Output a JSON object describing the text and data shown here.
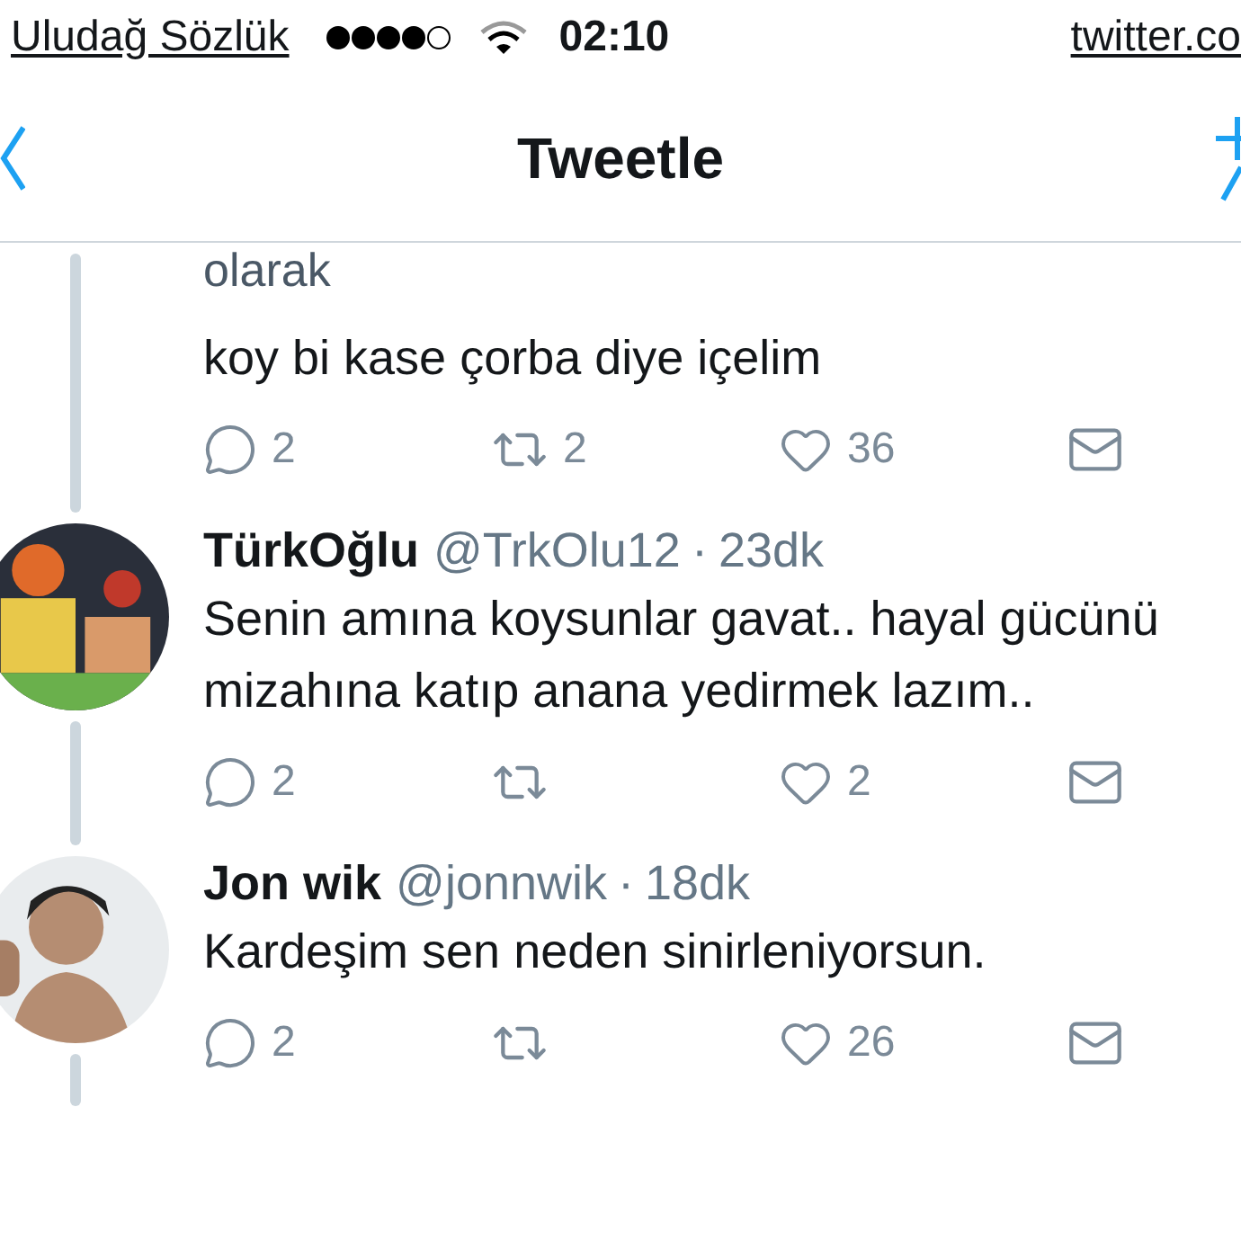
{
  "status_bar": {
    "carrier": "Uludağ Sözlük",
    "time": "02:10",
    "url": "twitter.co"
  },
  "nav": {
    "title": "Tweetle"
  },
  "tweets": [
    {
      "context": "olarak",
      "text": "koy bi kase çorba diye içelim",
      "actions": [
        {
          "kind": "reply",
          "count": "2"
        },
        {
          "kind": "retweet",
          "count": "2"
        },
        {
          "kind": "like",
          "count": "36"
        },
        {
          "kind": "message"
        }
      ]
    },
    {
      "name": "TürkOğlu",
      "handle": "@TrkOlu12",
      "dot": "·",
      "time": "23dk",
      "text": "Senin amına koysunlar gavat.. hayal gücünü mizahına katıp anana yedirmek lazım..",
      "actions": [
        {
          "kind": "reply",
          "count": "2"
        },
        {
          "kind": "retweet"
        },
        {
          "kind": "like",
          "count": "2"
        },
        {
          "kind": "message"
        }
      ]
    },
    {
      "name": "Jon wik",
      "handle": "@jonnwik",
      "dot": "·",
      "time": "18dk",
      "text": "Kardeşim sen neden sinirleniyorsun.",
      "actions": [
        {
          "kind": "reply",
          "count": "2"
        },
        {
          "kind": "retweet"
        },
        {
          "kind": "like",
          "count": "26"
        },
        {
          "kind": "message"
        }
      ]
    }
  ]
}
